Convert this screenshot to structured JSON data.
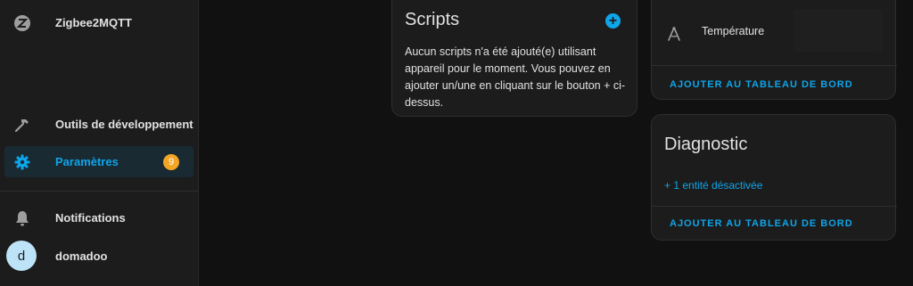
{
  "sidebar": {
    "top_item": {
      "label": "Zigbee2MQTT",
      "icon": "zigbee-icon"
    },
    "items": [
      {
        "label": "Outils de développement",
        "icon": "hammer-icon"
      },
      {
        "label": "Paramètres",
        "icon": "gear-icon",
        "badge": "9",
        "active": true
      }
    ],
    "notifications": {
      "label": "Notifications",
      "icon": "bell-icon"
    },
    "user": {
      "name": "domadoo",
      "initial": "d"
    }
  },
  "scripts_card": {
    "title": "Scripts",
    "body": "Aucun scripts n'a été ajouté(e) utilisant appareil pour le moment. Vous pouvez en ajouter un/une en cliquant sur le bouton + ci-dessus."
  },
  "sensor_card": {
    "entity_label": "Température",
    "action": "AJOUTER AU TABLEAU DE BORD"
  },
  "diagnostic_card": {
    "title": "Diagnostic",
    "link": "+ 1 entité désactivée",
    "action": "AJOUTER AU TABLEAU DE BORD"
  },
  "colors": {
    "accent": "#0ea5e9",
    "badge": "#f5a524",
    "background": "#111111",
    "card": "#1c1c1c"
  }
}
